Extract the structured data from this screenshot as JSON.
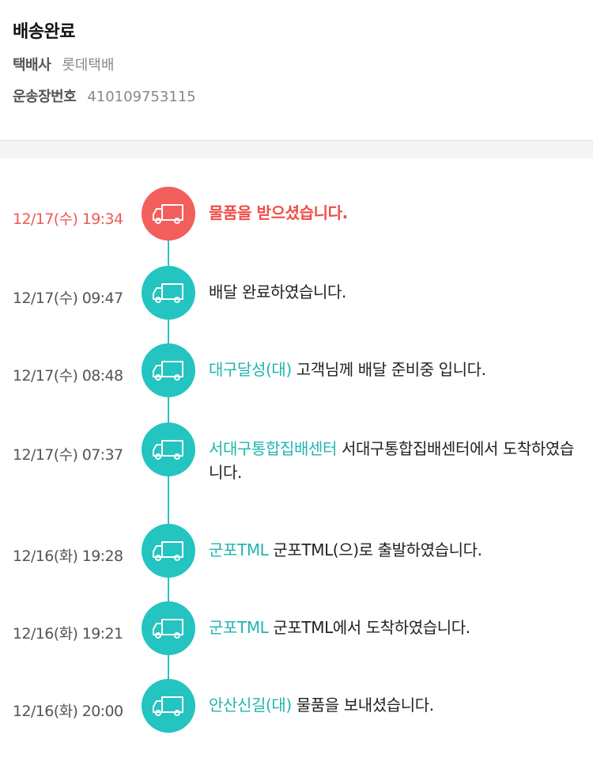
{
  "status_title": "배송완료",
  "courier": {
    "label": "택배사",
    "value": "롯데택배"
  },
  "tracking": {
    "label": "운송장번호",
    "value": "410109753115"
  },
  "events": [
    {
      "time": "12/17(수) 19:34",
      "location": "",
      "message": "물품을 받으셨습니다.",
      "current": true
    },
    {
      "time": "12/17(수) 09:47",
      "location": "",
      "message": "배달 완료하였습니다.",
      "current": false
    },
    {
      "time": "12/17(수) 08:48",
      "location": "대구달성(대)",
      "message": "고객님께 배달 준비중 입니다.",
      "current": false
    },
    {
      "time": "12/17(수) 07:37",
      "location": "서대구통합집배센터",
      "message": "서대구통합집배센터에서 도착하였습니다.",
      "current": false
    },
    {
      "time": "12/16(화) 19:28",
      "location": "군포TML",
      "message": "군포TML(으)로 출발하였습니다.",
      "current": false
    },
    {
      "time": "12/16(화) 19:21",
      "location": "군포TML",
      "message": "군포TML에서 도착하였습니다.",
      "current": false
    },
    {
      "time": "12/16(화) 20:00",
      "location": "안산신길(대)",
      "message": "물품을 보내셨습니다.",
      "current": false
    }
  ],
  "icon": "delivery-truck-icon",
  "colors": {
    "accent": "#24c4c0",
    "current": "#f25f5c",
    "location_text": "#1fb5b1"
  }
}
